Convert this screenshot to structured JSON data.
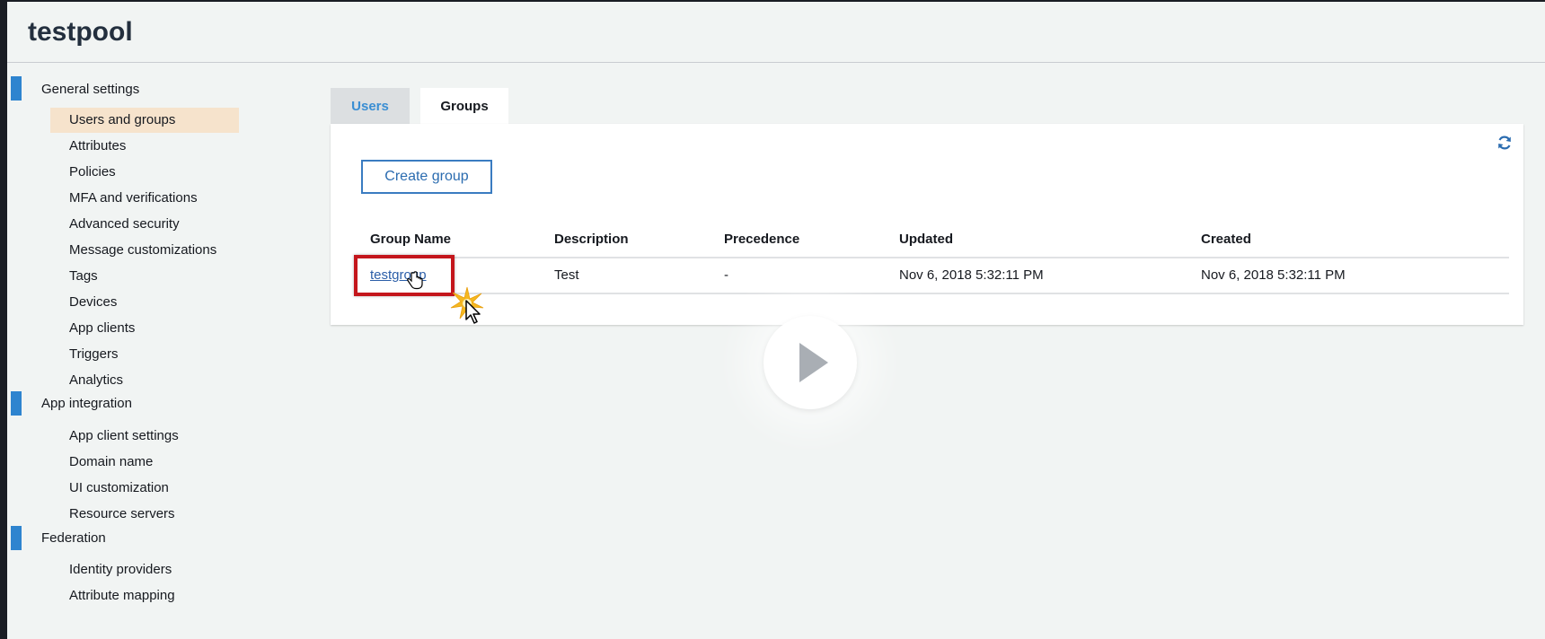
{
  "app": {
    "title": "testpool"
  },
  "sidebar": {
    "sections": [
      {
        "label": "General settings",
        "items": [
          "Users and groups",
          "Attributes",
          "Policies",
          "MFA and verifications",
          "Advanced security",
          "Message customizations",
          "Tags",
          "Devices",
          "App clients",
          "Triggers",
          "Analytics"
        ]
      },
      {
        "label": "App integration",
        "items": [
          "App client settings",
          "Domain name",
          "UI customization",
          "Resource servers"
        ]
      },
      {
        "label": "Federation",
        "items": [
          "Identity providers",
          "Attribute mapping"
        ]
      }
    ],
    "active_item": "Users and groups"
  },
  "tabs": [
    {
      "label": "Users",
      "active": false
    },
    {
      "label": "Groups",
      "active": true
    }
  ],
  "panel": {
    "create_button": "Create group",
    "refresh_icon": "refresh-icon",
    "columns": [
      "Group Name",
      "Description",
      "Precedence",
      "Updated",
      "Created"
    ],
    "rows": [
      [
        "testgroup",
        "Test",
        "-",
        "Nov 6, 2018 5:32:11 PM",
        "Nov 6, 2018 5:32:11 PM"
      ]
    ]
  },
  "colors": {
    "accent": "#2e84cf",
    "active_nav_bg": "#f6e3cc",
    "highlight": "#c4161c",
    "link": "#2b5ea8"
  },
  "overlay": {
    "play_icon": "play-icon"
  }
}
